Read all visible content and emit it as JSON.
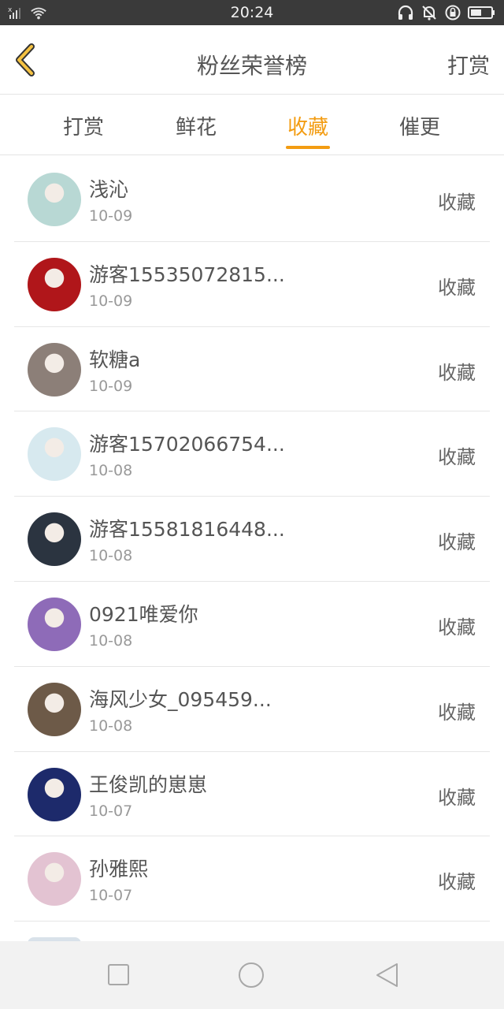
{
  "status_bar": {
    "time": "20:24",
    "left_icons": [
      "signal-icon",
      "wifi-icon"
    ],
    "right_icons": [
      "headphones-icon",
      "mute-bell-icon",
      "rotation-lock-icon",
      "battery-icon"
    ]
  },
  "header": {
    "back_icon": "chevron-left-icon",
    "title": "粉丝荣誉榜",
    "action_label": "打赏"
  },
  "tabs": [
    {
      "label": "打赏",
      "active": false
    },
    {
      "label": "鲜花",
      "active": false
    },
    {
      "label": "收藏",
      "active": true
    },
    {
      "label": "催更",
      "active": false
    }
  ],
  "colors": {
    "accent": "#f39c12",
    "text": "#555555",
    "secondary_text": "#999999",
    "status_bar": "#3a3a3a",
    "nav_bar": "#f2f2f2"
  },
  "list": [
    {
      "name": "浅沁",
      "date": "10-09",
      "action": "收藏",
      "avatar_color": "#b8d8d4"
    },
    {
      "name": "游客15535072815...",
      "date": "10-09",
      "action": "收藏",
      "avatar_color": "#b0161a"
    },
    {
      "name": "软糖a",
      "date": "10-09",
      "action": "收藏",
      "avatar_color": "#8c7f78"
    },
    {
      "name": "游客15702066754...",
      "date": "10-08",
      "action": "收藏",
      "avatar_color": "#d7e9ef"
    },
    {
      "name": "游客15581816448...",
      "date": "10-08",
      "action": "收藏",
      "avatar_color": "#2b3440"
    },
    {
      "name": "0921唯爱你",
      "date": "10-08",
      "action": "收藏",
      "avatar_color": "#8e6bb8"
    },
    {
      "name": "海风少女_095459...",
      "date": "10-08",
      "action": "收藏",
      "avatar_color": "#6d5a48"
    },
    {
      "name": "王俊凯的崽崽",
      "date": "10-07",
      "action": "收藏",
      "avatar_color": "#1d2a6b"
    },
    {
      "name": "孙雅熙",
      "date": "10-07",
      "action": "收藏",
      "avatar_color": "#e3c3d2"
    }
  ],
  "nav_bar": {
    "icons": [
      "recents-square-icon",
      "home-circle-icon",
      "back-triangle-icon"
    ]
  }
}
